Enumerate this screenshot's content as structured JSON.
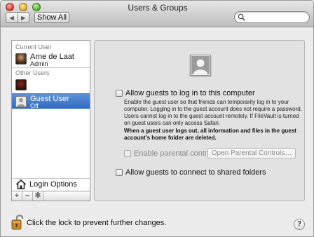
{
  "window": {
    "title": "Users & Groups"
  },
  "toolbar": {
    "back_icon": "chevron-left-icon",
    "forward_icon": "chevron-right-icon",
    "back_glyph": "◀",
    "forward_glyph": "▶",
    "show_all_label": "Show All",
    "search_placeholder": "",
    "search_icon": "search-icon"
  },
  "sidebar": {
    "current_user_header": "Current User",
    "current_user": {
      "name": "Arne de Laat",
      "role": "Admin"
    },
    "other_users_header": "Other Users",
    "other_users": [
      {
        "name": "",
        "role": ""
      },
      {
        "name": "Guest User",
        "role": "Off",
        "selected": true
      }
    ],
    "login_options_label": "Login Options",
    "add_glyph": "+",
    "remove_glyph": "−",
    "action_glyph": "✻"
  },
  "panel": {
    "allow_login_label": "Allow guests to log in to this computer",
    "allow_login_checked": false,
    "description": "Enable the guest user so that friends can temporarily log in to your computer. Logging in to the guest account does not require a password. Users cannot log in to the guest account remotely. If FileVault is turned on guest users can only access Safari.",
    "warning": "When a guest user logs out, all information and files in the guest account’s home folder are deleted.",
    "parental_controls_label": "Enable parental controls",
    "parental_controls_checked": false,
    "open_parental_label": "Open Parental Controls…",
    "shared_folders_label": "Allow guests to connect to shared folders",
    "shared_folders_checked": false
  },
  "footer": {
    "lock_text": "Click the lock to prevent further changes.",
    "help_label": "?"
  },
  "colors": {
    "selection": "#3b73c8",
    "window_bg": "#ececec",
    "panel_bg": "#e2e2e2"
  }
}
